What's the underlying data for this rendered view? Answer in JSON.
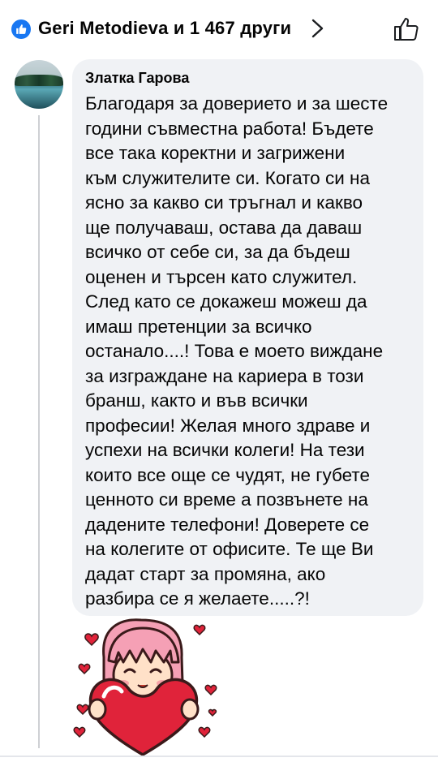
{
  "reactions": {
    "text": "Geri Metodieva и 1 467 други",
    "like_badge_color": "#1877f2",
    "icons": [
      "like-icon",
      "chevron-right-icon",
      "thumbs-up-icon"
    ]
  },
  "comment": {
    "author": "Златка Гарова",
    "lines": [
      "Благодаря за доверието и за шесте",
      "години съвместна работа! Бъдете",
      "все така коректни и загрижени",
      "към служителите си. Когато си на",
      "ясно за какво си тръгнал и какво",
      "ще получаваш,  остава да даваш",
      "всичко от себе си,  за да бъдеш",
      "оценен и търсен като служител.",
      "След като се докажеш можеш да",
      "имаш претенции за всичко",
      "останало....! Това е моето виждане",
      "за изграждане на кариера в този",
      "бранш,  както и във всички",
      "професии! Желая много здраве и",
      "успехи на всички колеги! На тези",
      "които все още се чудят,  не губете",
      "ценното си време а позвънете на",
      "дадените телефони! Доверете се",
      "на колегите от офисите. Те ще Ви",
      "дадат старт за промяна,  ако",
      "разбира се я желаете.....?!"
    ],
    "bubble_color": "#f0f2f5",
    "sticker": "girl-holding-heart-sticker"
  }
}
